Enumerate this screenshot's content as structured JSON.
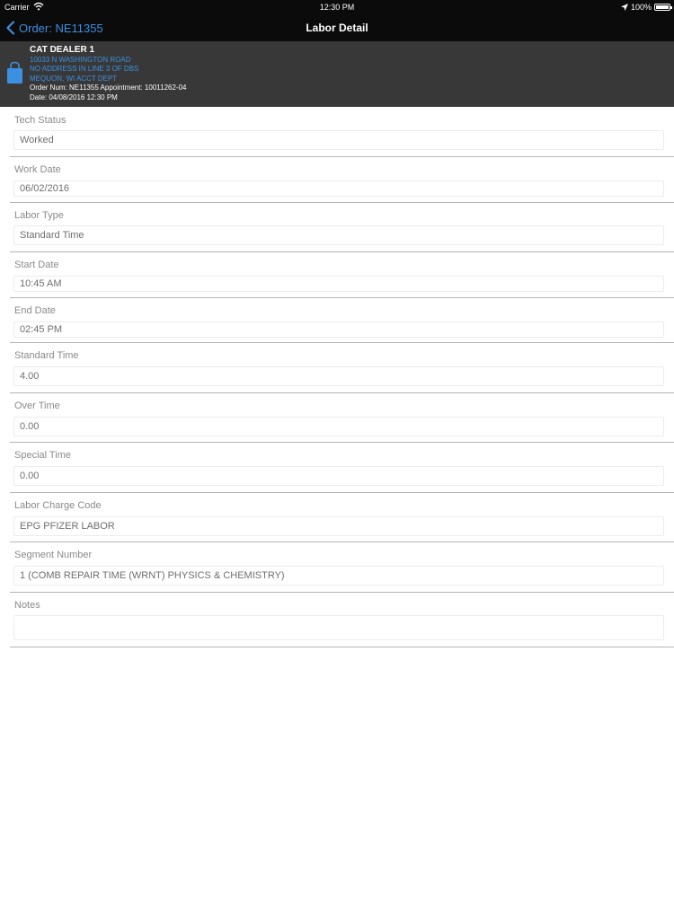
{
  "status_bar": {
    "carrier": "Carrier",
    "time": "12:30 PM",
    "battery": "100%"
  },
  "nav": {
    "back_label": "Order: NE11355",
    "title": "Labor Detail"
  },
  "order_header": {
    "dealer": "CAT DEALER 1",
    "address_line1": "10033 N WASHINGTON ROAD",
    "address_line2": "NO ADDRESS IN LINE 3 OF DBS",
    "address_line3": "MEQUON, WI ACCT DEPT",
    "order_line": "Order Num: NE11355 Appointment: 10011262-04",
    "date_line": "Date: 04/08/2016 12:30 PM"
  },
  "colors": {
    "accent": "#3d8fe0",
    "bar": "#0b0b0b",
    "header": "#383838"
  },
  "fields": {
    "tech_status": {
      "label": "Tech Status",
      "value": "Worked"
    },
    "work_date": {
      "label": "Work Date",
      "value": "06/02/2016"
    },
    "labor_type": {
      "label": "Labor Type",
      "value": "Standard Time"
    },
    "start_date": {
      "label": "Start Date",
      "value": "10:45 AM"
    },
    "end_date": {
      "label": "End Date",
      "value": "02:45 PM"
    },
    "standard_time": {
      "label": "Standard Time",
      "value": "4.00"
    },
    "over_time": {
      "label": "Over Time",
      "value": "0.00"
    },
    "special_time": {
      "label": "Special Time",
      "value": "0.00"
    },
    "labor_charge_code": {
      "label": "Labor Charge Code",
      "value": "EPG PFIZER LABOR"
    },
    "segment_number": {
      "label": "Segment Number",
      "value": "1 (COMB REPAIR TIME (WRNT) PHYSICS & CHEMISTRY)"
    },
    "notes": {
      "label": "Notes",
      "value": ""
    }
  }
}
